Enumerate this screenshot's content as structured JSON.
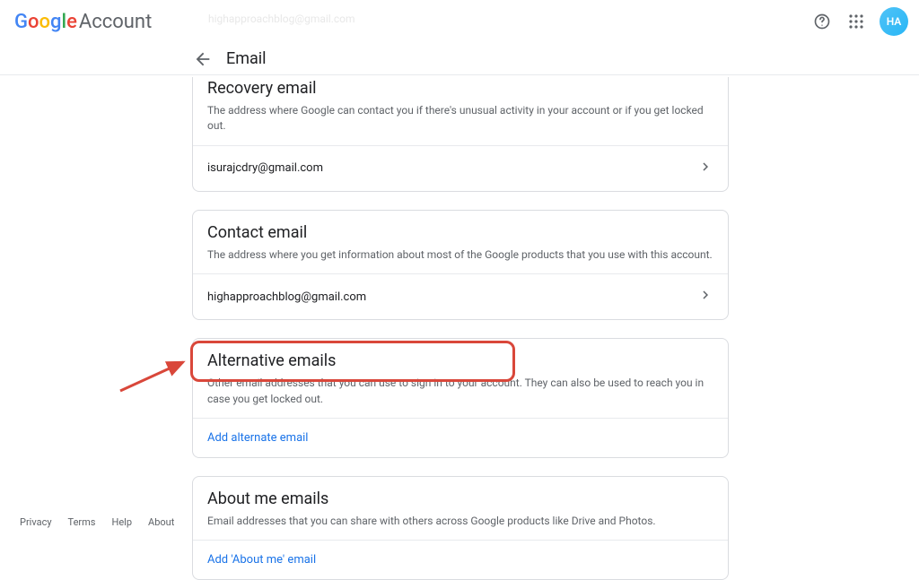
{
  "header": {
    "logo_brand": "Google",
    "logo_product": "Account",
    "faded_email": "highapproachblog@gmail.com",
    "avatar_initials": "HA"
  },
  "subheader": {
    "title": "Email"
  },
  "recovery": {
    "title": "Recovery email",
    "desc": "The address where Google can contact you if there's unusual activity in your account or if you get locked out.",
    "value": "isurajcdry@gmail.com"
  },
  "contact": {
    "title": "Contact email",
    "desc": "The address where you get information about most of the Google products that you use with this account.",
    "value": "highapproachblog@gmail.com"
  },
  "alternative": {
    "title": "Alternative emails",
    "desc": "Other email addresses that you can use to sign in to your account. They can also be used to reach you in case you get locked out.",
    "link": "Add alternate email"
  },
  "about": {
    "title": "About me emails",
    "desc": "Email addresses that you can share with others across Google products like Drive and Photos.",
    "link": "Add 'About me' email"
  },
  "footer": {
    "privacy": "Privacy",
    "terms": "Terms",
    "help": "Help",
    "about": "About"
  }
}
